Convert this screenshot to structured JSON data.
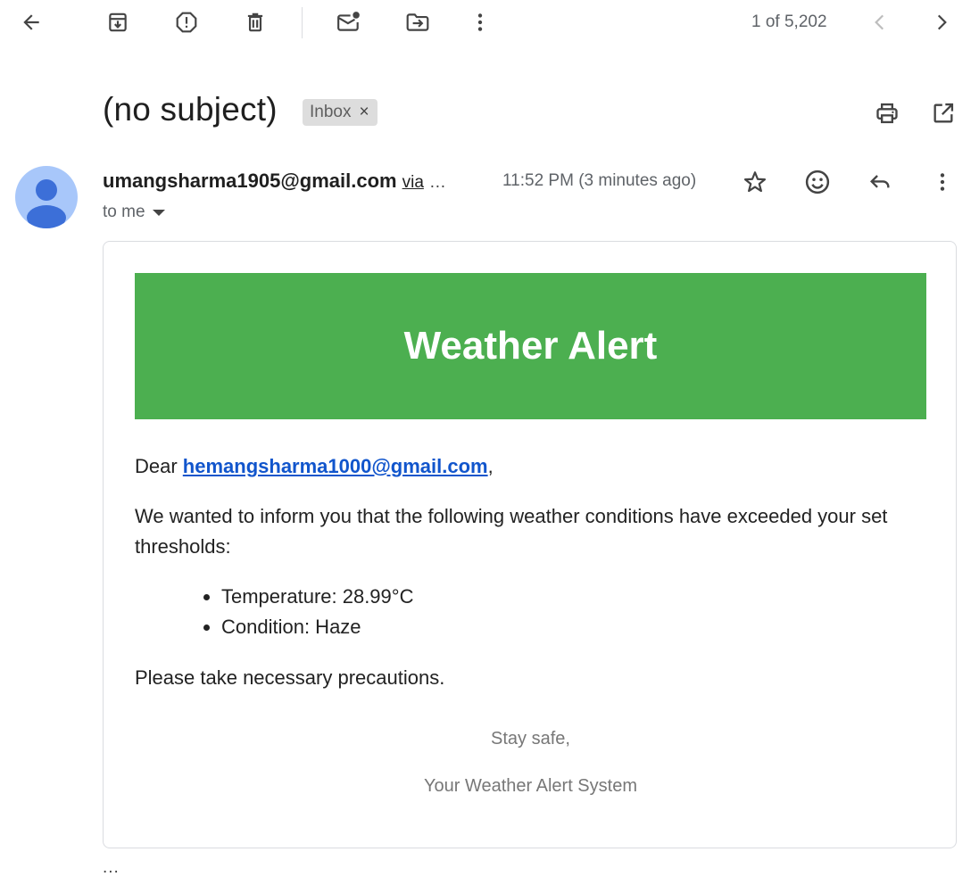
{
  "toolbar": {
    "back_icon": "arrow-left-icon",
    "actions": [
      {
        "name": "archive",
        "icon": "archive-icon"
      },
      {
        "name": "report-spam",
        "icon": "report-spam-icon"
      },
      {
        "name": "delete",
        "icon": "trash-icon"
      },
      {
        "name": "mark-unread",
        "icon": "mark-unread-icon"
      },
      {
        "name": "move-to",
        "icon": "move-to-icon"
      },
      {
        "name": "more",
        "icon": "more-vert-icon"
      }
    ],
    "pager": {
      "text": "1 of 5,202",
      "prev_icon": "chevron-left-icon",
      "next_icon": "chevron-right-icon"
    }
  },
  "message": {
    "subject": "(no subject)",
    "label": "Inbox",
    "label_remove": "×",
    "header_actions": {
      "print_icon": "print-icon",
      "open_new_window_icon": "open-in-new-icon"
    },
    "sender": {
      "email": "umangsharma1905@gmail.com",
      "via": "via",
      "via_more": "…",
      "avatar_icon": "person-avatar-icon"
    },
    "time": "11:52 PM (3 minutes ago)",
    "recipient_summary": "to me",
    "row_actions": {
      "star_icon": "star-icon",
      "emoji_icon": "emoji-icon",
      "reply_icon": "reply-icon",
      "more_icon": "more-vert-icon"
    },
    "trimmed_content": "..."
  },
  "email_body": {
    "banner_title": "Weather Alert",
    "banner_color": "#4caf50",
    "greeting_prefix": "Dear ",
    "greeting_email": "hemangsharma1000@gmail.com",
    "greeting_suffix": ",",
    "intro": "We wanted to inform you that the following weather conditions have exceeded your set thresholds:",
    "items": [
      "Temperature: 28.99°C",
      "Condition: Haze"
    ],
    "precaution": "Please take necessary precautions.",
    "signoff": "Stay safe,",
    "signature": "Your Weather Alert System"
  }
}
